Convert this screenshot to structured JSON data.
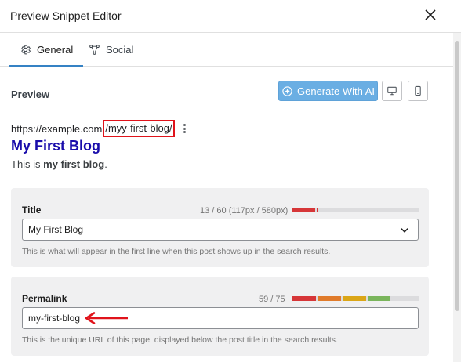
{
  "dialog": {
    "title": "Preview Snippet Editor"
  },
  "tabs": [
    {
      "label": "General",
      "icon": "gear-icon",
      "active": true
    },
    {
      "label": "Social",
      "icon": "share-icon",
      "active": false
    }
  ],
  "preview": {
    "label": "Preview",
    "generate_button": "Generate With AI",
    "url_base": "https://example.com",
    "url_slug": "/myy-first-blog/",
    "blog_title": "My First Blog",
    "description_prefix": "This is ",
    "description_bold": "my first blog",
    "description_suffix": "."
  },
  "title_field": {
    "label": "Title",
    "counter": "13 / 60 (117px / 580px)",
    "value": "My First Blog",
    "help": "This is what will appear in the first line when this post shows up in the search results.",
    "progress": 0.2
  },
  "permalink_field": {
    "label": "Permalink",
    "counter": "59 / 75",
    "value": "my-first-blog",
    "help": "This is the unique URL of this page, displayed below the post title in the search results.",
    "progress": 0.79
  },
  "colors": {
    "accent": "#3582c4",
    "ai_button": "#6aaee3",
    "link_title": "#1a0dab",
    "highlight_red": "#e0131b",
    "meter_red": "#d63638",
    "meter_orange": "#e07b2b",
    "meter_yellow": "#dba617",
    "meter_green": "#7ab55c"
  }
}
